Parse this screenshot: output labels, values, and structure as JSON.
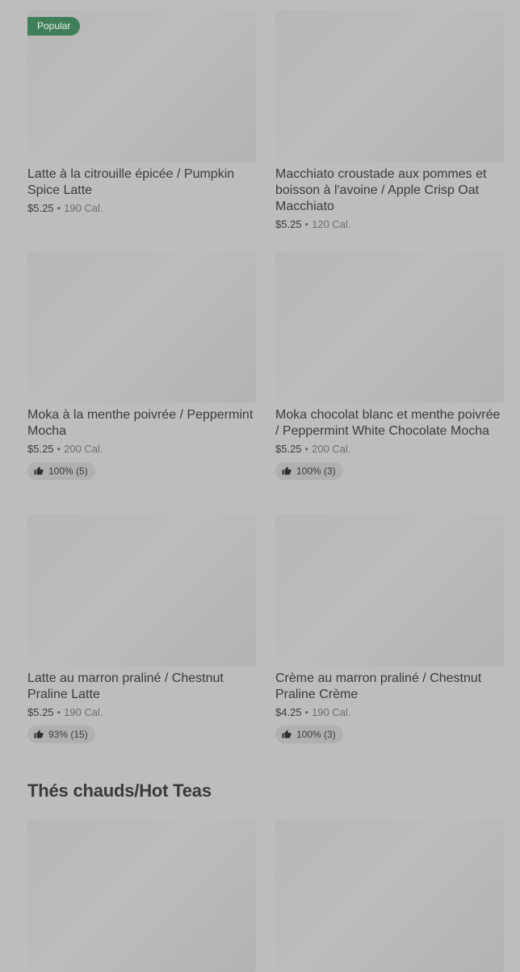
{
  "items": [
    {
      "badge": "Popular",
      "title": "Latte à la citrouille épicée / Pumpkin Spice Latte",
      "price": "$5.25",
      "dot": "•",
      "calories": "190 Cal."
    },
    {
      "title": "Macchiato croustade aux pommes et boisson à l'avoine / Apple Crisp Oat Macchiato",
      "price": "$5.25",
      "dot": "•",
      "calories": "120 Cal."
    },
    {
      "title": "Moka à la menthe poivrée / Peppermint Mocha",
      "price": "$5.25",
      "dot": "•",
      "calories": "200 Cal.",
      "rating": "100% (5)"
    },
    {
      "title": "Moka chocolat blanc et menthe poivrée / Peppermint White Chocolate Mocha",
      "price": "$5.25",
      "dot": "•",
      "calories": "200 Cal.",
      "rating": "100% (3)"
    },
    {
      "title": "Latte au marron praliné / Chestnut Praline Latte",
      "price": "$5.25",
      "dot": "•",
      "calories": "190 Cal.",
      "rating": "93% (15)"
    },
    {
      "title": "Crème au marron praliné  / Chestnut Praline Crème",
      "price": "$4.25",
      "dot": "•",
      "calories": "190 Cal.",
      "rating": "100% (3)"
    }
  ],
  "section": {
    "title": "Thés chauds/Hot Teas"
  },
  "icons": {
    "rating": "thumbs-up-icon"
  },
  "colors": {
    "badge": "#3f7f5a",
    "background": "#bdbdbd"
  }
}
